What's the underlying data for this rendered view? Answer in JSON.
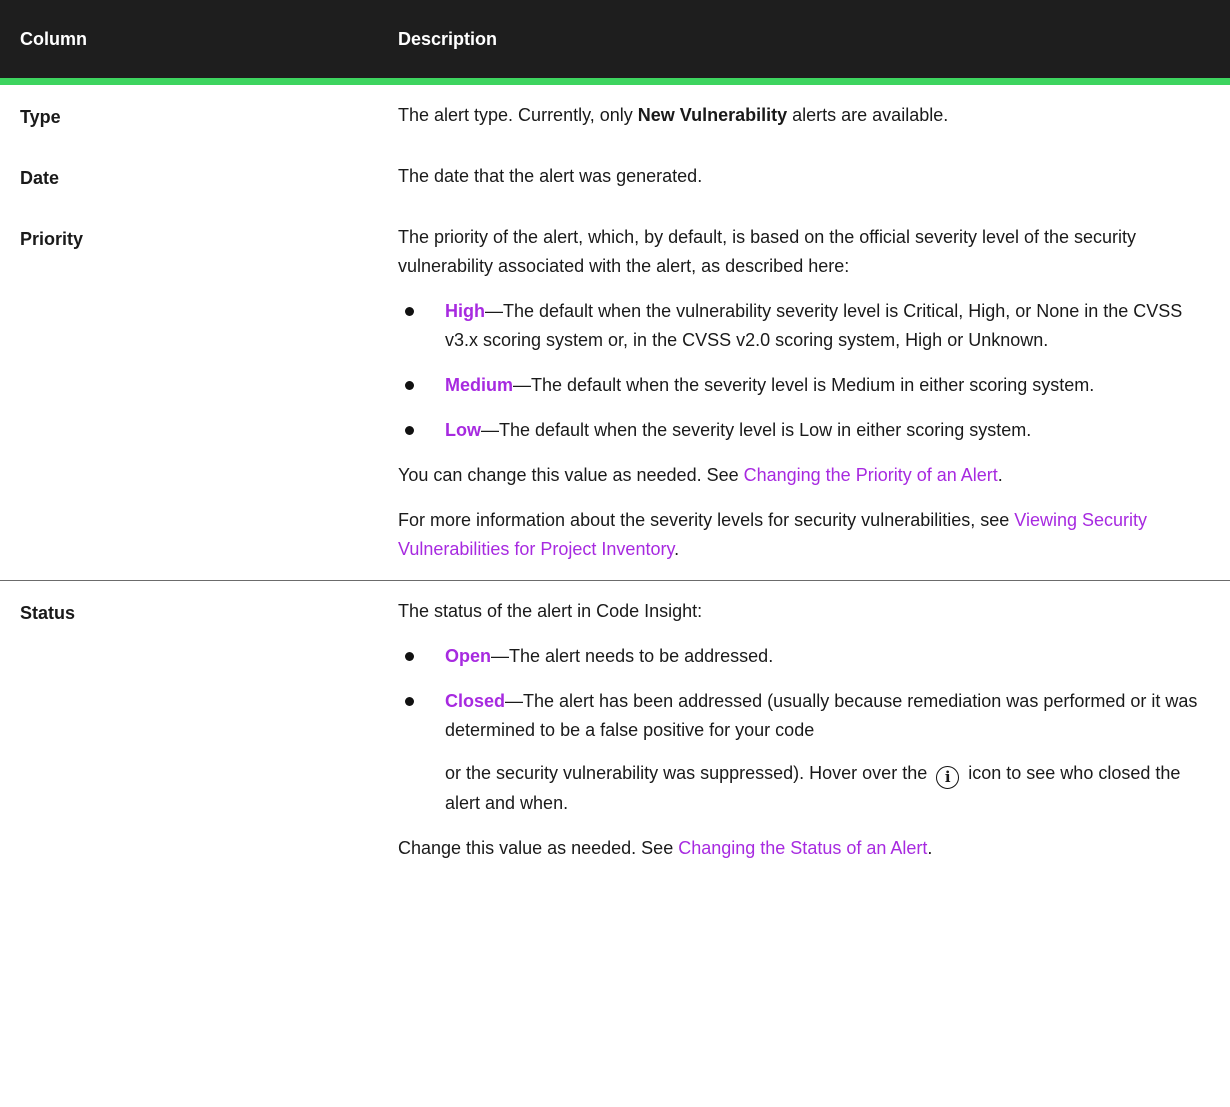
{
  "headers": {
    "column": "Column",
    "description": "Description"
  },
  "rows": {
    "type": {
      "name": "Type",
      "pre": "The alert type. Currently, only ",
      "bold": "New Vulnerability",
      "post": " alerts are available."
    },
    "date": {
      "name": "Date",
      "text": "The date that the alert was generated."
    },
    "priority": {
      "name": "Priority",
      "intro": "The priority of the alert, which, by default, is based on the official severity level of the security vulnerability associated with the alert, as described here:",
      "bullets": [
        {
          "term": "High",
          "text": "—The default when the vulnerability severity level is Critical, High, or None in the CVSS v3.x scoring system or, in the CVSS v2.0 scoring system, High or Unknown."
        },
        {
          "term": "Medium",
          "text": "—The default when the severity level is Medium in either scoring system."
        },
        {
          "term": "Low",
          "text": "—The default when the severity level is Low in either scoring system."
        }
      ],
      "change_pre": "You can change this value as needed. See ",
      "change_link": "Changing the Priority of an Alert",
      "change_post": ".",
      "more_pre": "For more information about the severity levels for security vulnerabilities, see ",
      "more_link": "Viewing Security Vulnerabilities for Project Inventory",
      "more_post": "."
    },
    "status": {
      "name": "Status",
      "intro": "The status of the alert in Code Insight:",
      "open_term": "Open",
      "open_text": "—The alert needs to be addressed.",
      "closed_term": "Closed",
      "closed_text_a": "—The alert has been addressed (usually because remediation was performed or it was determined to be a false positive for your code",
      "closed_text_b": "or the security vulnerability was suppressed). Hover over the",
      "closed_text_c": "icon to see who closed the alert and when.",
      "info_icon": "info-circle-icon",
      "change_pre": "Change this value as needed. See ",
      "change_link": "Changing the Status of an Alert",
      "change_post": "."
    }
  }
}
